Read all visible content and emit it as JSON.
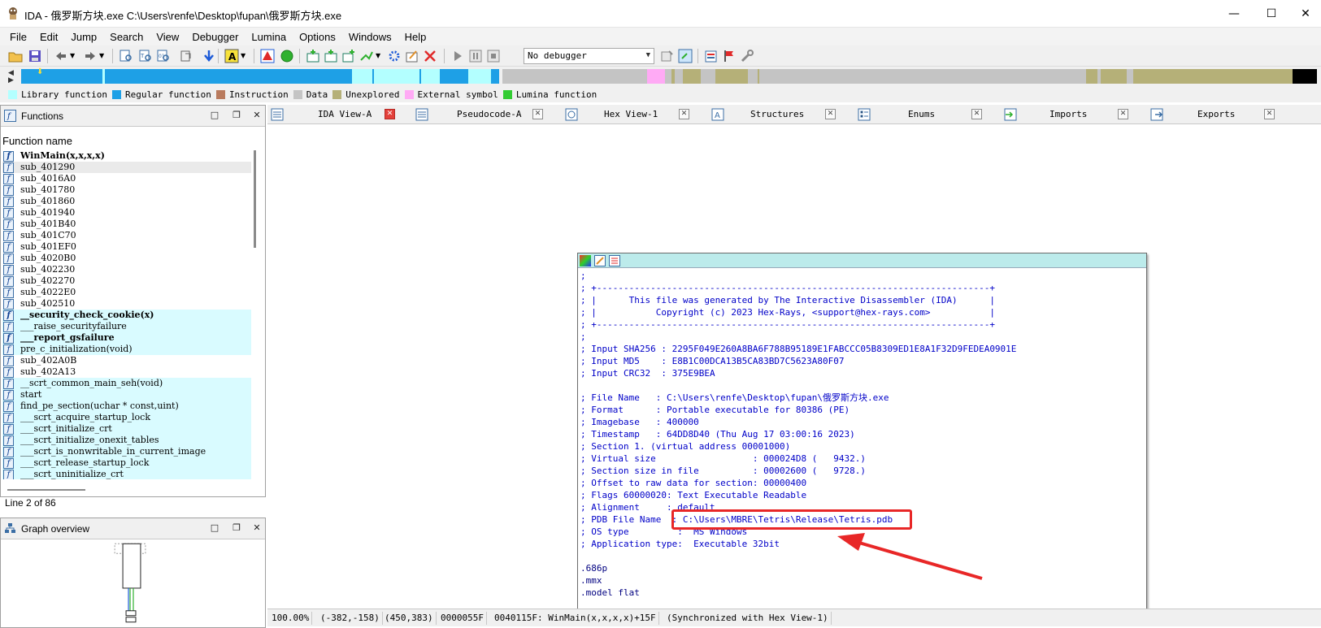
{
  "window": {
    "title": "IDA - 俄罗斯方块.exe C:\\Users\\renfe\\Desktop\\fupan\\俄罗斯方块.exe",
    "minimize": "—",
    "maximize": "☐",
    "close": "✕"
  },
  "menu": [
    "File",
    "Edit",
    "Jump",
    "Search",
    "View",
    "Debugger",
    "Lumina",
    "Options",
    "Windows",
    "Help"
  ],
  "toolbar": {
    "debugger_select": "No debugger",
    "icons": [
      "open-icon",
      "save-icon",
      "back-icon",
      "forward-icon",
      "find-code-icon",
      "find-text-icon",
      "find-binary-icon",
      "jump-icon",
      "go-down-icon",
      "mark-icon",
      "warning-icon",
      "green-circle-icon",
      "function-new-icon",
      "segment-icon",
      "add-icon",
      "struct-icon",
      "gear-icon",
      "edit-icon",
      "delete-icon",
      "run-icon",
      "pause-icon",
      "stop-icon",
      "attach-icon",
      "detach-icon",
      "options-icon",
      "flag-icon",
      "tools-icon"
    ]
  },
  "legend": [
    {
      "label": "Library function",
      "color": "#b3ffff"
    },
    {
      "label": "Regular function",
      "color": "#1ea0e6"
    },
    {
      "label": "Instruction",
      "color": "#b97b5e"
    },
    {
      "label": "Data",
      "color": "#c4c4c4"
    },
    {
      "label": "Unexplored",
      "color": "#b5b078"
    },
    {
      "label": "External symbol",
      "color": "#ffaaf5"
    },
    {
      "label": "Lumina function",
      "color": "#33cc33"
    }
  ],
  "functions_panel": {
    "title": "Functions",
    "column_header": "Function name",
    "status": "Line 2 of 86",
    "rows": [
      {
        "name": "WinMain(x,x,x,x)",
        "kind": "regular",
        "bold": true
      },
      {
        "name": "sub_401290",
        "kind": "selected",
        "bold": false
      },
      {
        "name": "sub_4016A0",
        "kind": "regular",
        "bold": false
      },
      {
        "name": "sub_401780",
        "kind": "regular",
        "bold": false
      },
      {
        "name": "sub_401860",
        "kind": "regular",
        "bold": false
      },
      {
        "name": "sub_401940",
        "kind": "regular",
        "bold": false
      },
      {
        "name": "sub_401B40",
        "kind": "regular",
        "bold": false
      },
      {
        "name": "sub_401C70",
        "kind": "regular",
        "bold": false
      },
      {
        "name": "sub_401EF0",
        "kind": "regular",
        "bold": false
      },
      {
        "name": "sub_4020B0",
        "kind": "regular",
        "bold": false
      },
      {
        "name": "sub_402230",
        "kind": "regular",
        "bold": false
      },
      {
        "name": "sub_402270",
        "kind": "regular",
        "bold": false
      },
      {
        "name": "sub_4022E0",
        "kind": "regular",
        "bold": false
      },
      {
        "name": "sub_402510",
        "kind": "regular",
        "bold": false
      },
      {
        "name": "__security_check_cookie(x)",
        "kind": "library",
        "bold": true
      },
      {
        "name": "___raise_securityfailure",
        "kind": "library",
        "bold": false
      },
      {
        "name": "___report_gsfailure",
        "kind": "library",
        "bold": true
      },
      {
        "name": "pre_c_initialization(void)",
        "kind": "library",
        "bold": false
      },
      {
        "name": "sub_402A0B",
        "kind": "regular",
        "bold": false
      },
      {
        "name": "sub_402A13",
        "kind": "regular",
        "bold": false
      },
      {
        "name": "__scrt_common_main_seh(void)",
        "kind": "library",
        "bold": false
      },
      {
        "name": "start",
        "kind": "library",
        "bold": false
      },
      {
        "name": "find_pe_section(uchar * const,uint)",
        "kind": "library",
        "bold": false
      },
      {
        "name": "___scrt_acquire_startup_lock",
        "kind": "library",
        "bold": false
      },
      {
        "name": "___scrt_initialize_crt",
        "kind": "library",
        "bold": false
      },
      {
        "name": "___scrt_initialize_onexit_tables",
        "kind": "library",
        "bold": false
      },
      {
        "name": "___scrt_is_nonwritable_in_current_image",
        "kind": "library",
        "bold": false
      },
      {
        "name": "___scrt_release_startup_lock",
        "kind": "library",
        "bold": false
      },
      {
        "name": "___scrt_uninitialize_crt",
        "kind": "library",
        "bold": false
      }
    ]
  },
  "graph_panel": {
    "title": "Graph overview"
  },
  "tabs": [
    {
      "label": "IDA View-A",
      "active": true
    },
    {
      "label": "Pseudocode-A",
      "active": false
    },
    {
      "label": "Hex View-1",
      "active": false
    },
    {
      "label": "Structures",
      "active": false
    },
    {
      "label": "Enums",
      "active": false
    },
    {
      "label": "Imports",
      "active": false
    },
    {
      "label": "Exports",
      "active": false
    }
  ],
  "disassembly": {
    "lines": [
      ";",
      "; +-------------------------------------------------------------------------+",
      "; |      This file was generated by The Interactive Disassembler (IDA)      |",
      "; |           Copyright (c) 2023 Hex-Rays, <support@hex-rays.com>           |",
      "; +-------------------------------------------------------------------------+",
      ";",
      "; Input SHA256 : 2295F049E260A8BA6F788B95189E1FABCCC05B8309ED1E8A1F32D9FEDEA0901E",
      "; Input MD5    : E8B1C00DCA13B5CA83BD7C5623A80F07",
      "; Input CRC32  : 375E9BEA",
      "",
      "; File Name   : C:\\Users\\renfe\\Desktop\\fupan\\俄罗斯方块.exe",
      "; Format      : Portable executable for 80386 (PE)",
      "; Imagebase   : 400000",
      "; Timestamp   : 64DD8D40 (Thu Aug 17 03:00:16 2023)",
      "; Section 1. (virtual address 00001000)",
      "; Virtual size                  : 000024D8 (   9432.)",
      "; Section size in file          : 00002600 (   9728.)",
      "; Offset to raw data for section: 00000400",
      "; Flags 60000020: Text Executable Readable",
      "; Alignment     : default",
      "; PDB File Name  : C:\\Users\\MBRE\\Tetris\\Release\\Tetris.pdb",
      "; OS type         :  MS Windows",
      "; Application type:  Executable 32bit",
      "",
      ".686p",
      ".mmx",
      ".model flat"
    ]
  },
  "statusbar": {
    "zoom": "100.00%",
    "offset": "(-382,-158)",
    "position": "(450,383)",
    "file_offset": "0000055F",
    "location": "0040115F: WinMain(x,x,x,x)+15F",
    "sync": "(Synchronized with Hex View-1)"
  },
  "colors": {
    "annotation_red": "#e82727",
    "library_bg": "#d9fbff",
    "regular_function": "#1ea0e6",
    "code_blue": "#0000c8"
  }
}
